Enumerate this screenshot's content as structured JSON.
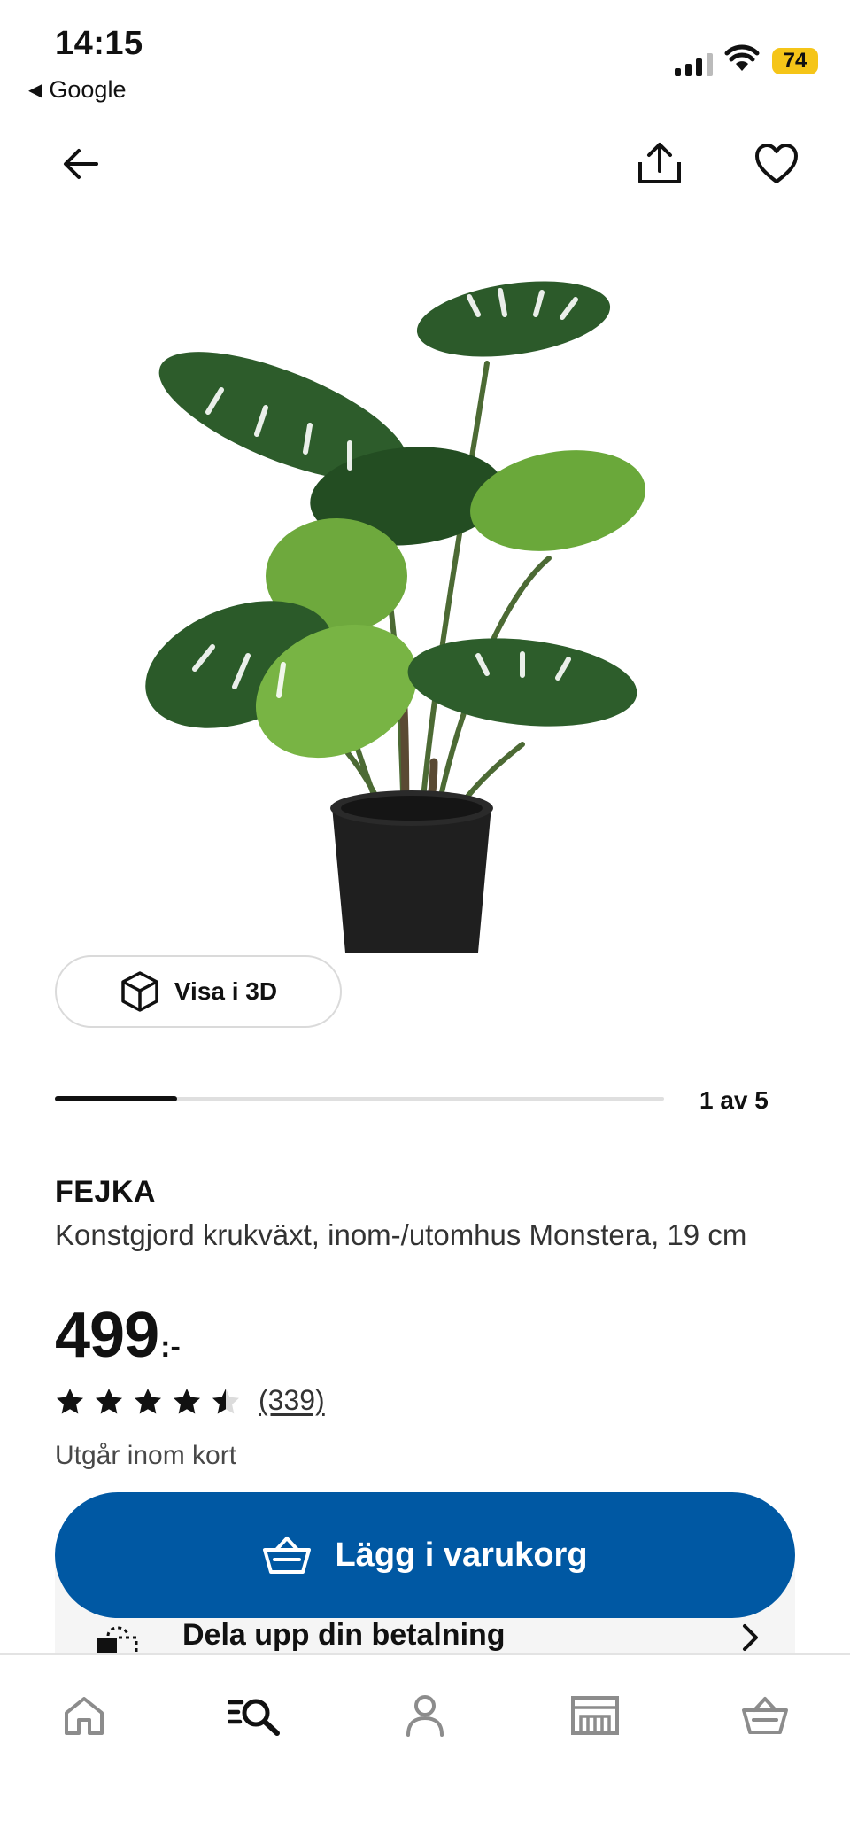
{
  "status_bar": {
    "time": "14:15",
    "back_app": "Google",
    "battery": "74",
    "battery_color": "#f5c518"
  },
  "nav": {
    "back_icon": "arrow-left-icon",
    "share_icon": "share-icon",
    "favorite_icon": "heart-icon"
  },
  "gallery": {
    "view_3d_label": "Visa i 3D",
    "page_indicator": "1 av 5",
    "current_page": 1,
    "total_pages": 5
  },
  "product": {
    "brand": "FEJKA",
    "description": "Konstgjord krukväxt, inom-/utomhus Monstera, 19 cm",
    "price": "499",
    "price_suffix": ":-",
    "rating": 4.5,
    "rating_max": 5,
    "review_count": "(339)",
    "status": "Utgår inom kort"
  },
  "actions": {
    "add_to_cart": "Lägg i varukorg",
    "installment": "Dela upp din betalning",
    "accent_color": "#0058a3"
  },
  "tabbar": {
    "items": [
      "home-icon",
      "search-icon",
      "profile-icon",
      "store-icon",
      "basket-icon"
    ]
  }
}
